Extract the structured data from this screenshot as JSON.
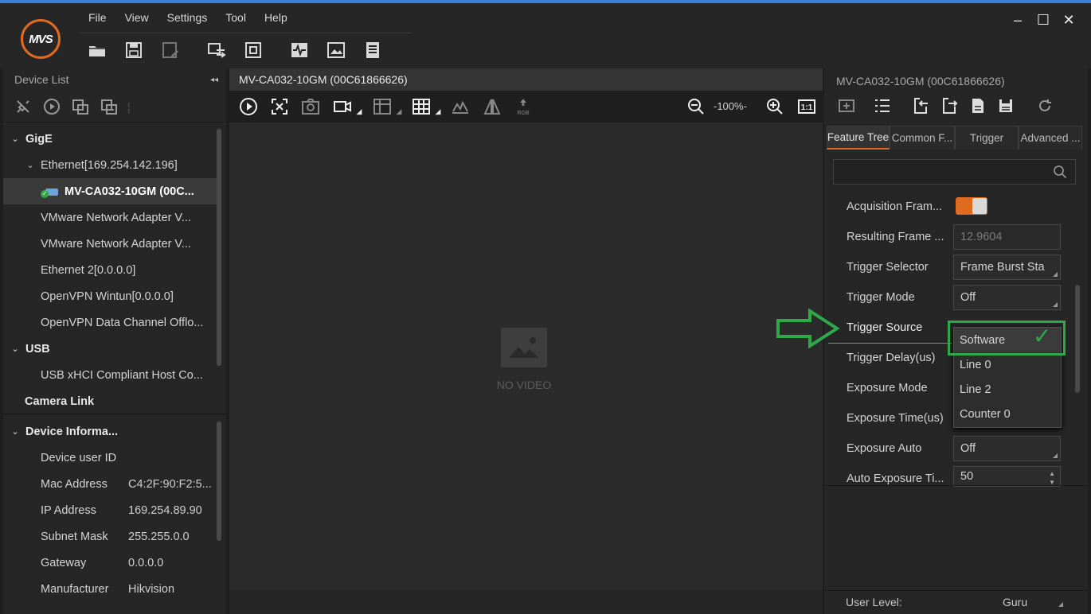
{
  "app": {
    "logo_text": "MVS"
  },
  "menu": [
    "File",
    "View",
    "Settings",
    "Tool",
    "Help"
  ],
  "toolbar_icons": [
    "open-folder-icon",
    "save-icon",
    "save-as-icon",
    "switch-view-icon",
    "window-icon",
    "waveform-icon",
    "image-edit-icon",
    "notes-icon"
  ],
  "window_controls": {
    "minimize": "–",
    "maximize": "☐",
    "close": "✕"
  },
  "device_list": {
    "title": "Device List",
    "tree": {
      "gige": "GigE",
      "ethernet": "Ethernet[169.254.142.196]",
      "camera": "MV-CA032-10GM (00C...",
      "vmware1": "VMware Network Adapter V...",
      "vmware2": "VMware Network Adapter V...",
      "ethernet2": "Ethernet 2[0.0.0.0]",
      "openvpn_wintun": "OpenVPN Wintun[0.0.0.0]",
      "openvpn_dco": "OpenVPN Data Channel Offlo...",
      "usb": "USB",
      "usb_xhci": "USB xHCI Compliant Host Co...",
      "camera_link": "Camera Link"
    }
  },
  "device_info": {
    "title": "Device Informa...",
    "rows": [
      {
        "key": "Device user ID",
        "value": ""
      },
      {
        "key": "Mac Address",
        "value": "C4:2F:90:F2:5..."
      },
      {
        "key": "IP Address",
        "value": "169.254.89.90"
      },
      {
        "key": "Subnet Mask",
        "value": "255.255.0.0"
      },
      {
        "key": "Gateway",
        "value": "0.0.0.0"
      },
      {
        "key": "Manufacturer",
        "value": "Hikvision"
      }
    ]
  },
  "center": {
    "tab": "MV-CA032-10GM (00C61866626)",
    "zoom": "-100%-",
    "rgb_label": "RGB",
    "no_video": "NO VIDEO"
  },
  "right": {
    "title": "MV-CA032-10GM (00C61866626)",
    "tabs": [
      "Feature Tree",
      "Common F...",
      "Trigger",
      "Advanced ..."
    ],
    "search_placeholder": "",
    "features": {
      "acq_frame": "Acquisition Fram...",
      "resulting_frame": "Resulting Frame ...",
      "resulting_frame_value": "12.9604",
      "trigger_selector": "Trigger Selector",
      "trigger_selector_value": "Frame Burst Sta",
      "trigger_mode": "Trigger Mode",
      "trigger_mode_value": "Off",
      "trigger_source": "Trigger Source",
      "trigger_delay": "Trigger Delay(us)",
      "exposure_mode": "Exposure Mode",
      "exposure_time": "Exposure Time(us)",
      "exposure_auto": "Exposure Auto",
      "exposure_auto_value": "Off",
      "auto_exposure_ti": "Auto Exposure Ti...",
      "auto_exposure_ti_value": "50"
    },
    "trigger_source_options": [
      "Software",
      "Line 0",
      "Line 2",
      "Counter 0"
    ],
    "check_mark": "✓",
    "user_level_label": "User Level:",
    "user_level_value": "Guru"
  },
  "colors": {
    "accent": "#e06b1f",
    "highlight_green": "#2fa84a",
    "title_blue": "#3a7fd6"
  }
}
